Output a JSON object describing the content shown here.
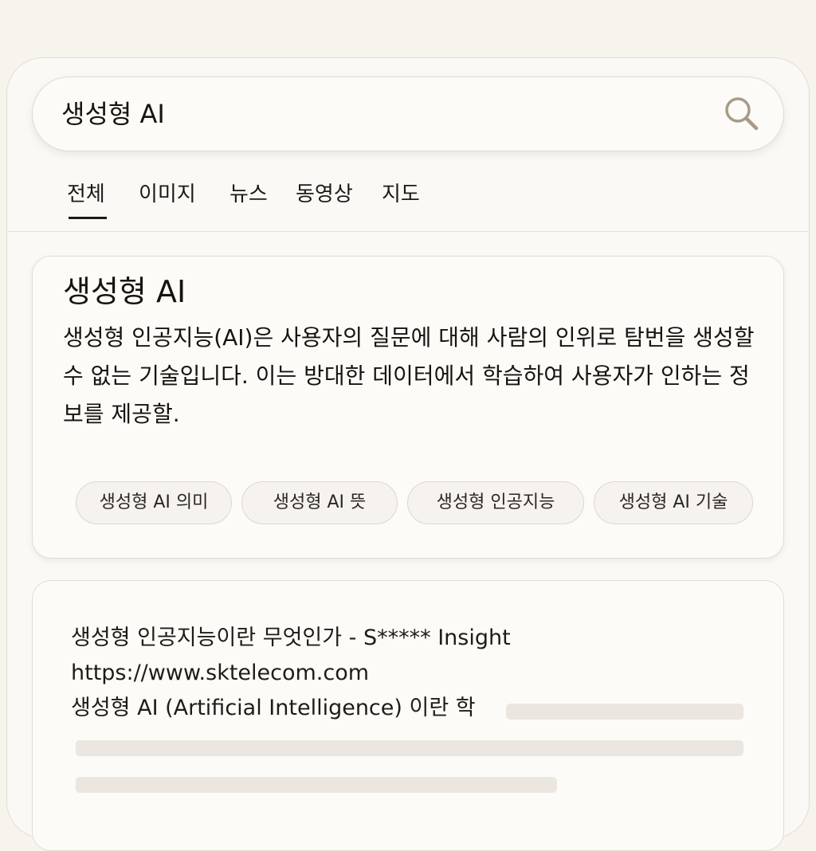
{
  "search": {
    "query": "생성형 AI",
    "icon": "search-icon"
  },
  "tabs": [
    {
      "label": "전체",
      "active": true
    },
    {
      "label": "이미지",
      "active": false
    },
    {
      "label": "뉴스",
      "active": false
    },
    {
      "label": "동영상",
      "active": false
    },
    {
      "label": "지도",
      "active": false
    }
  ],
  "summary": {
    "title": "생성형 AI",
    "body": "생성형 인공지능(AI)은 사용자의 질문에 대해 사람의 인위로 탐번을 생성할 수 없는 기술입니다. 이는 방대한 데이터에서 학습하여 사용자가 인하는 정보를 제공할.",
    "related": [
      "생성형 AI 의미",
      "생성형 AI 뜻",
      "생성형 인공지능",
      "생성형 AI 기술"
    ]
  },
  "result": {
    "title": "생성형 인공지능이란 무엇인가 - S***** Insight",
    "url": "https://www.sktelecom.com",
    "snippet": "생성형 AI (Artificial Intelligence) 이란 학"
  },
  "colors": {
    "background": "#f7f4ee",
    "card": "#fdfbf8",
    "border": "#e2ddd4",
    "placeholder": "#ebe7e0",
    "text": "#1c1a17"
  }
}
